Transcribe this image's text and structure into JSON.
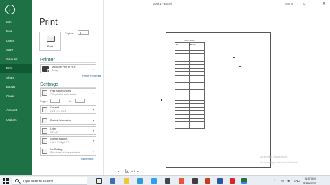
{
  "window": {
    "title": "Book1 - Excel",
    "user": "Sign in",
    "minimize": "—",
    "close": "✕",
    "feedback_icon": "smiley-icon"
  },
  "nav": {
    "back_icon": "back-arrow-icon",
    "items": [
      "Info",
      "New",
      "Open",
      "Save",
      "Save As",
      "Print",
      "Share",
      "Export",
      "Close",
      "Account",
      "Options"
    ],
    "active": "Print"
  },
  "print": {
    "title": "Print",
    "button_label": "Print",
    "copies_label": "Copies:",
    "copies_value": "1"
  },
  "printer": {
    "heading": "Printer",
    "name": "Microsoft Print to PDF",
    "status": "Ready",
    "properties_link": "Printer Properties"
  },
  "settings": {
    "heading": "Settings",
    "scope_main": "Print Active Sheets",
    "scope_sub": "Only print the active sheets",
    "pages_label": "Pages:",
    "to_label": "to",
    "collate_main": "Collated",
    "collate_sub": "1,2,3   1,2,3   1,2,3",
    "orientation_main": "Portrait Orientation",
    "paper_main": "Letter",
    "paper_sub": "8.5\" x 11\"",
    "margins_main": "Normal Margins",
    "margins_sub": "Left: 0.7\"   Right: 0.7\"",
    "scaling_main": "No Scaling",
    "scaling_sub": "Print sheets at their actual size",
    "page_setup_link": "Page Setup"
  },
  "preview": {
    "sheet_title": "Result Sheet",
    "header_no": "No",
    "header_name": "Name",
    "rows": [
      "",
      "",
      "",
      "",
      "",
      "",
      "",
      "",
      "",
      "",
      "",
      "",
      "",
      "",
      "",
      "",
      "",
      "",
      "",
      "",
      "",
      "",
      ""
    ],
    "page_current": "1",
    "page_of": "of 1",
    "activate_title": "Activate Windows",
    "activate_sub": "Go to Settings to activate Windows."
  },
  "taskbar": {
    "search_placeholder": "Type here to search",
    "time": "6:47 AM",
    "date": "5/16/2020",
    "tray_chevron": "^",
    "language": "ENG"
  },
  "colors": {
    "accent": "#1e7145",
    "taskbar": "#e9eef4"
  }
}
